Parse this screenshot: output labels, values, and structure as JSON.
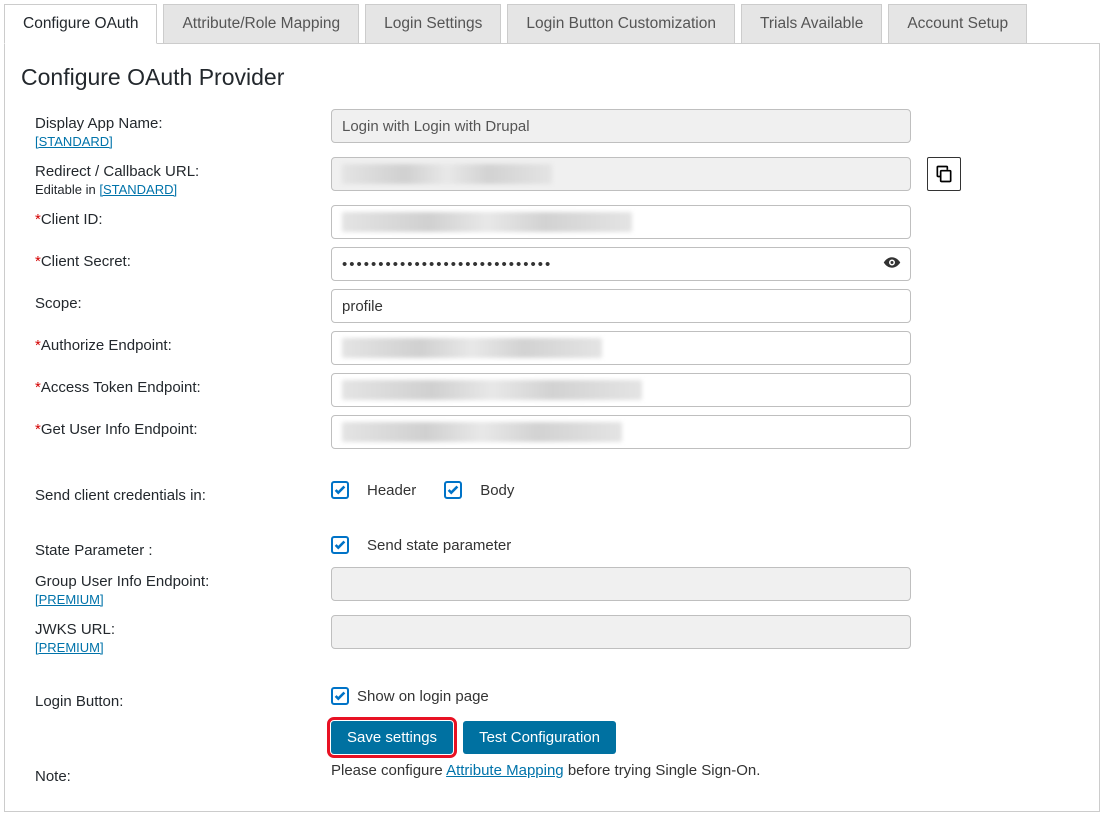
{
  "tabs": {
    "configure_oauth": "Configure OAuth",
    "attribute_role_mapping": "Attribute/Role Mapping",
    "login_settings": "Login Settings",
    "login_button_customization": "Login Button Customization",
    "trials_available": "Trials Available",
    "account_setup": "Account Setup"
  },
  "page_title": "Configure OAuth Provider",
  "badges": {
    "standard": "[STANDARD]",
    "premium": "[PREMIUM]"
  },
  "labels": {
    "display_app_name": "Display App Name:",
    "redirect_callback": "Redirect / Callback URL:",
    "editable_in_prefix": "Editable in ",
    "client_id": "Client ID:",
    "client_secret": "Client Secret:",
    "scope": "Scope:",
    "authorize_endpoint": "Authorize Endpoint:",
    "access_token_endpoint": "Access Token Endpoint:",
    "get_user_info_endpoint": "Get User Info Endpoint:",
    "send_client_credentials": "Send client credentials in:",
    "state_parameter": "State Parameter :",
    "group_user_info_endpoint": "Group User Info Endpoint:",
    "jwks_url": "JWKS URL:",
    "login_button": "Login Button:",
    "note": "Note:"
  },
  "fields": {
    "display_app_name_value": "Login with Login with Drupal",
    "client_secret_mask": "•••••••••••••••••••••••••••••",
    "scope_value": "profile"
  },
  "checkbox_labels": {
    "header": "Header",
    "body": "Body",
    "send_state_parameter": "Send state parameter",
    "show_on_login_page": "Show on login page"
  },
  "buttons": {
    "save_settings": "Save settings",
    "test_configuration": "Test Configuration"
  },
  "note_text": {
    "prefix": "Please configure ",
    "link": "Attribute Mapping",
    "suffix": " before trying Single Sign-On."
  }
}
